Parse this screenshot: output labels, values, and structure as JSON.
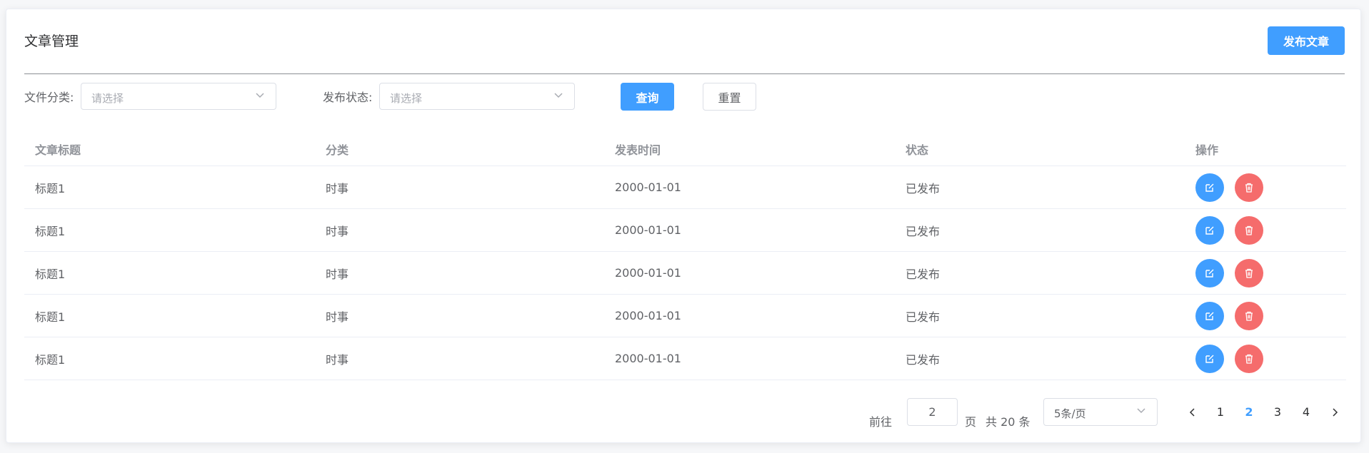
{
  "header": {
    "title": "文章管理",
    "publish_label": "发布文章"
  },
  "filters": {
    "category_label": "文件分类:",
    "category_placeholder": "请选择",
    "status_label": "发布状态:",
    "status_placeholder": "请选择",
    "query_label": "查询",
    "reset_label": "重置"
  },
  "table": {
    "columns": [
      "文章标题",
      "分类",
      "发表时间",
      "状态",
      "操作"
    ],
    "rows": [
      {
        "title": "标题1",
        "category": "时事",
        "date": "2000-01-01",
        "status": "已发布"
      },
      {
        "title": "标题1",
        "category": "时事",
        "date": "2000-01-01",
        "status": "已发布"
      },
      {
        "title": "标题1",
        "category": "时事",
        "date": "2000-01-01",
        "status": "已发布"
      },
      {
        "title": "标题1",
        "category": "时事",
        "date": "2000-01-01",
        "status": "已发布"
      },
      {
        "title": "标题1",
        "category": "时事",
        "date": "2000-01-01",
        "status": "已发布"
      }
    ],
    "actions": {
      "edit_icon": "edit-icon",
      "delete_icon": "trash-icon"
    }
  },
  "pagination": {
    "goto_label": "前往",
    "goto_value": "2",
    "page_unit": "页",
    "total_text": "共 20 条",
    "page_size": "5条/页",
    "pages": [
      "1",
      "2",
      "3",
      "4"
    ],
    "current_page": "2"
  },
  "colors": {
    "primary": "#409eff",
    "danger": "#f56c6c"
  }
}
